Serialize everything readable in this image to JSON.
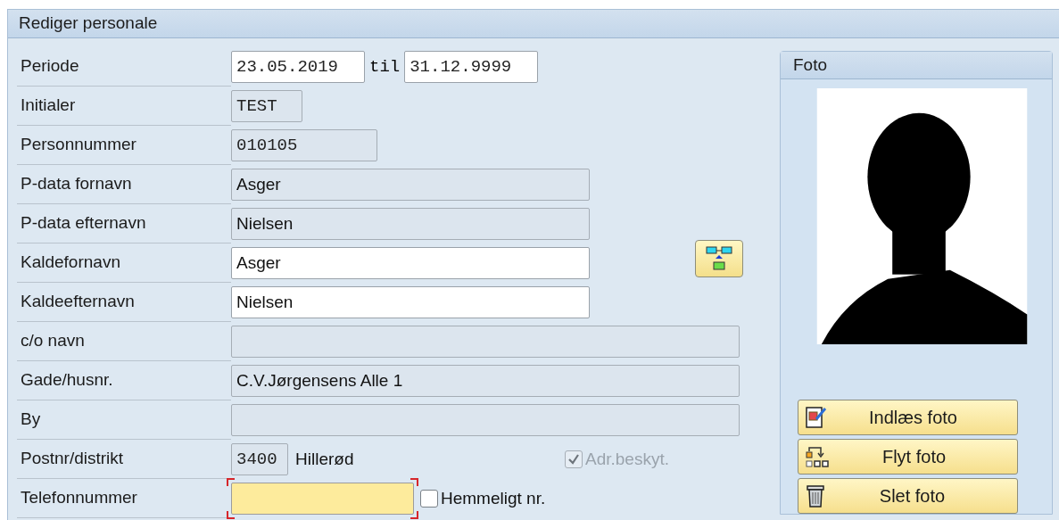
{
  "window": {
    "title": "Rediger personale"
  },
  "rows": [
    {
      "label": "Periode",
      "kind": "period",
      "from": {
        "value": "23.05.2019",
        "readonly": false
      },
      "separator": "til",
      "to": {
        "value": "31.12.9999",
        "readonly": false
      }
    },
    {
      "label": "Initialer",
      "kind": "code",
      "field": {
        "value": "TEST",
        "readonly": true
      }
    },
    {
      "label": "Personnummer",
      "kind": "code",
      "field": {
        "value": "010105",
        "readonly": true
      }
    },
    {
      "label": "P-data fornavn",
      "kind": "text",
      "field": {
        "value": "Asger",
        "readonly": true
      }
    },
    {
      "label": "P-data efternavn",
      "kind": "text",
      "field": {
        "value": "Nielsen",
        "readonly": true
      }
    },
    {
      "label": "Kaldefornavn",
      "kind": "text",
      "field": {
        "value": "Asger",
        "readonly": false
      }
    },
    {
      "label": "Kaldeefternavn",
      "kind": "text",
      "field": {
        "value": "Nielsen",
        "readonly": false
      }
    },
    {
      "label": "c/o navn",
      "kind": "text",
      "field": {
        "readonly": true
      }
    },
    {
      "label": "Gade/husnr.",
      "kind": "text",
      "field": {
        "value": "C.V.Jørgensens Alle 1",
        "readonly": true
      }
    },
    {
      "label": "By",
      "kind": "text",
      "field": {
        "readonly": true
      }
    },
    {
      "label": "Postnr/distrikt",
      "kind": "postal",
      "field": {
        "value": "3400",
        "readonly": true
      },
      "district": "Hillerød",
      "checkbox": {
        "label": "Adr.beskyt.",
        "checked": true,
        "disabled": true
      }
    },
    {
      "label": "Telefonnummer",
      "kind": "phone",
      "field": {
        "readonly": false,
        "highlighted": true
      },
      "checkbox": {
        "label": "Hemmeligt nr.",
        "checked": false,
        "disabled": false
      }
    }
  ],
  "photo_panel": {
    "title": "Foto",
    "buttons": [
      "Indlæs foto",
      "Flyt foto",
      "Slet foto"
    ]
  }
}
